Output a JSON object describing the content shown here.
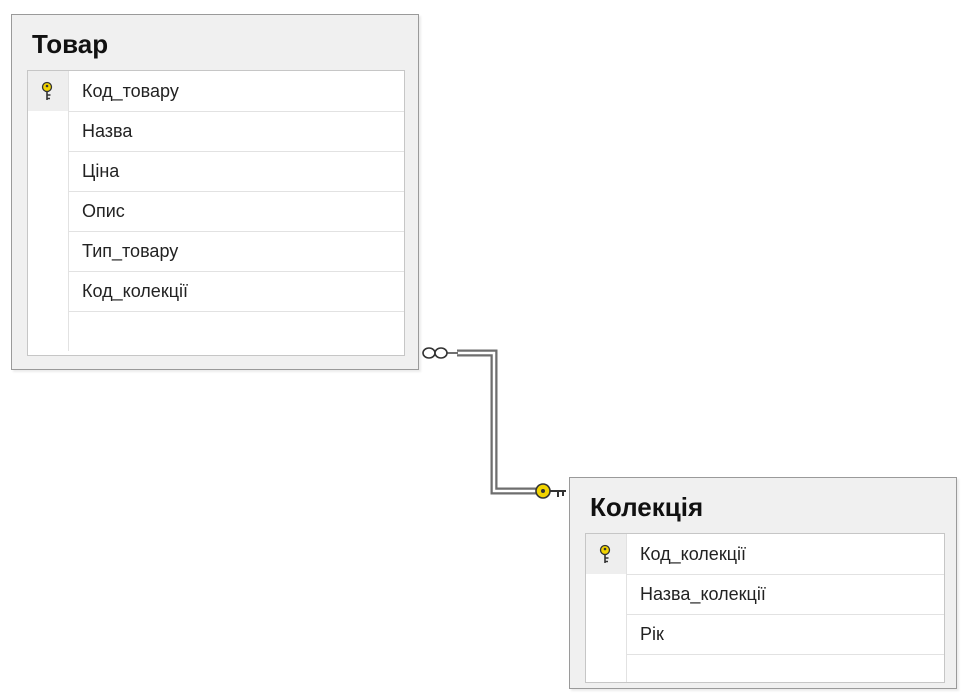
{
  "diagram": {
    "tables": [
      {
        "id": "tovar",
        "title": "Товар",
        "columns": [
          {
            "name": "Код_товару",
            "primary_key": true
          },
          {
            "name": "Назва",
            "primary_key": false
          },
          {
            "name": "Ціна",
            "primary_key": false
          },
          {
            "name": "Опис",
            "primary_key": false
          },
          {
            "name": "Тип_товару",
            "primary_key": false
          },
          {
            "name": "Код_колекції",
            "primary_key": false
          }
        ]
      },
      {
        "id": "kolektsiia",
        "title": "Колекція",
        "columns": [
          {
            "name": "Код_колекції",
            "primary_key": true
          },
          {
            "name": "Назва_колекції",
            "primary_key": false
          },
          {
            "name": "Рік",
            "primary_key": false
          }
        ]
      }
    ],
    "relationships": [
      {
        "from_table": "Товар",
        "from_end": "many-infinity-icon",
        "to_table": "Колекція",
        "to_end": "one-key-icon"
      }
    ],
    "colors": {
      "key_icon": "#d8b400",
      "connector": "#6e6e6e",
      "table_frame": "#f0f0f0"
    }
  }
}
